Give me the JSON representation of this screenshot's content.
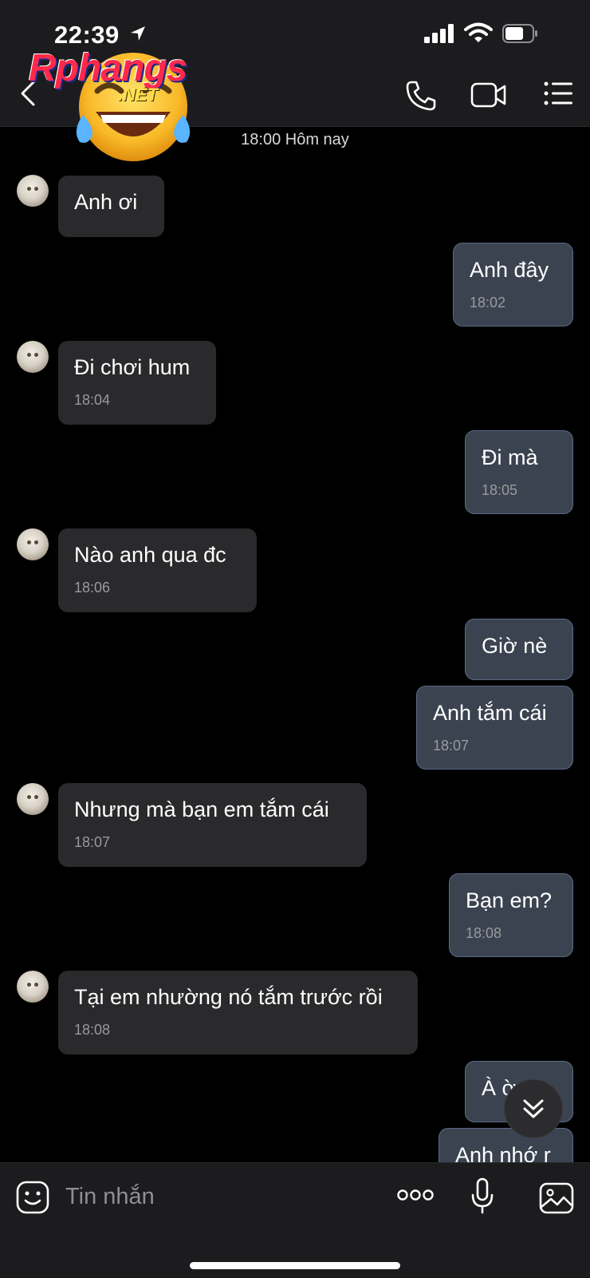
{
  "status_bar": {
    "time": "22:39"
  },
  "watermark": {
    "brand": "Rphangs",
    "tld": ".NET"
  },
  "chat": {
    "date_divider": "18:00 Hôm nay",
    "messages": [
      {
        "side": "in",
        "text": "Anh ơi",
        "time": ""
      },
      {
        "side": "out",
        "text": "Anh đây",
        "time": "18:02"
      },
      {
        "side": "in",
        "text": "Đi chơi hum",
        "time": "18:04"
      },
      {
        "side": "out",
        "text": "Đi mà",
        "time": "18:05"
      },
      {
        "side": "in",
        "text": "Nào anh qua đc",
        "time": "18:06"
      },
      {
        "side": "out",
        "text": "Giờ nè",
        "time": ""
      },
      {
        "side": "out",
        "text": "Anh tắm cái",
        "time": "18:07"
      },
      {
        "side": "in",
        "text": "Nhưng mà bạn em tắm cái",
        "time": "18:07"
      },
      {
        "side": "out",
        "text": "Bạn em?",
        "time": "18:08"
      },
      {
        "side": "in",
        "text": "Tại em nhường nó tắm trước rồi",
        "time": "18:08"
      },
      {
        "side": "out",
        "text": "À ờ",
        "time": ""
      },
      {
        "side": "out",
        "text": "Anh nhớ r",
        "time": ""
      }
    ]
  },
  "composer": {
    "placeholder": "Tin nhắn"
  },
  "colors": {
    "background": "#000000",
    "bar": "#1c1c1e",
    "bubble_in": "#2a2a2c",
    "bubble_out": "#3b4350"
  }
}
